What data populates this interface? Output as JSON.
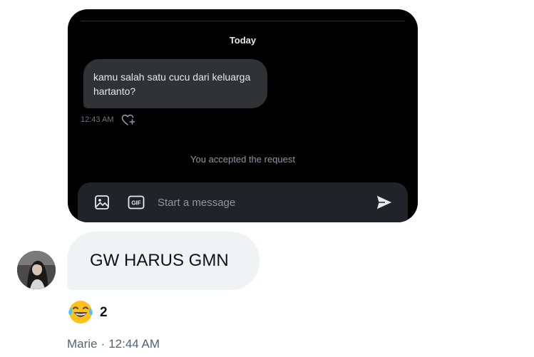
{
  "embedded_dm": {
    "date_separator": "Today",
    "message": {
      "text": "kamu salah satu cucu dari keluarga hartanto?",
      "time": "12:43 AM"
    },
    "system_note": "You accepted the request",
    "composer": {
      "placeholder": "Start a message",
      "gif_label": "GIF"
    },
    "colors": {
      "background": "#000000",
      "bubble": "#2f3336",
      "composer": "#202327",
      "accent_icon": "#e7e9ea"
    }
  },
  "chat": {
    "reply_text": "GW HARUS GMN",
    "reaction": {
      "emoji": "😂",
      "emoji_icon": "face-with-tears-of-joy-icon",
      "count": "2"
    },
    "sender_name": "Marie",
    "separator": "·",
    "time": "12:44 AM",
    "colors": {
      "bubble": "#eff3f4",
      "text": "#0f1419",
      "meta": "#536471"
    }
  }
}
